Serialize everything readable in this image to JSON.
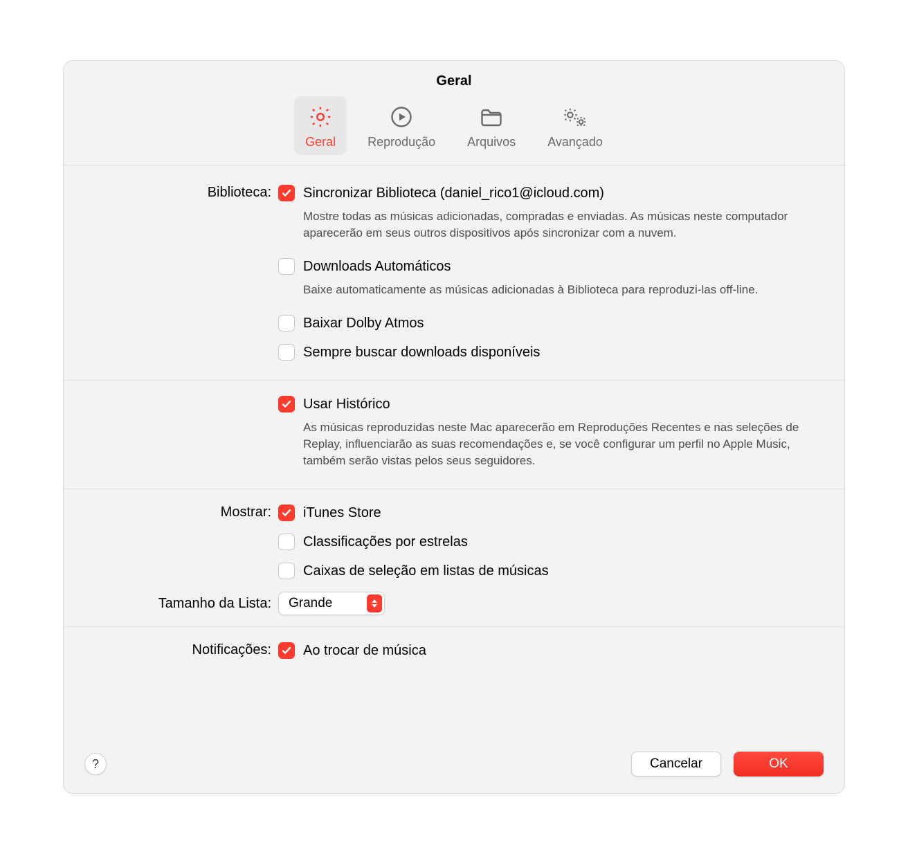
{
  "window": {
    "title": "Geral"
  },
  "tabs": {
    "general": "Geral",
    "playback": "Reprodução",
    "files": "Arquivos",
    "advanced": "Avançado"
  },
  "sections": {
    "library": {
      "label": "Biblioteca:",
      "sync": {
        "label": "Sincronizar Biblioteca",
        "account": "(daniel_rico1@icloud.com)",
        "desc": "Mostre todas as músicas adicionadas, compradas e enviadas. As músicas neste computador aparecerão em seus outros dispositivos após sincronizar com a nuvem.",
        "checked": true
      },
      "auto_dl": {
        "label": "Downloads Automáticos",
        "desc": "Baixe automaticamente as músicas adicionadas à Biblioteca para reproduzi-las off-line.",
        "checked": false
      },
      "dolby": {
        "label": "Baixar Dolby Atmos",
        "checked": false
      },
      "always_check": {
        "label": "Sempre buscar downloads disponíveis",
        "checked": false
      },
      "history": {
        "label": "Usar Histórico",
        "desc": "As músicas reproduzidas neste Mac aparecerão em Reproduções Recentes e nas seleções de Replay, influenciarão as suas recomendações e, se você configurar um perfil no Apple Music, também serão vistas pelos seus seguidores.",
        "checked": true
      }
    },
    "show": {
      "label": "Mostrar:",
      "itunes": {
        "label": "iTunes Store",
        "checked": true
      },
      "stars": {
        "label": "Classificações por estrelas",
        "checked": false
      },
      "checkboxes": {
        "label": "Caixas de seleção em listas de músicas",
        "checked": false
      }
    },
    "list_size": {
      "label": "Tamanho da Lista:",
      "value": "Grande"
    },
    "notifications": {
      "label": "Notificações:",
      "song_change": {
        "label": "Ao trocar de música",
        "checked": true
      }
    }
  },
  "buttons": {
    "help": "?",
    "cancel": "Cancelar",
    "ok": "OK"
  }
}
